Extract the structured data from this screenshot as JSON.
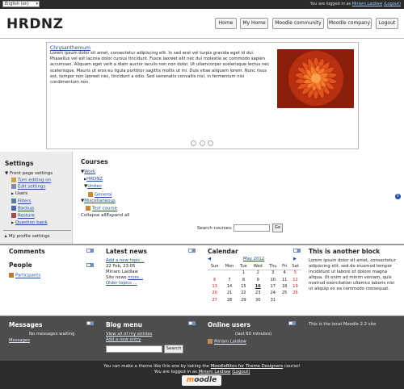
{
  "topbar": {
    "language": "English (en)",
    "logged_in_prefix": "You are logged in as",
    "user": "Miriam Laidlaw",
    "logout": "(Logout)"
  },
  "header": {
    "site_title": "HRDNZ",
    "nav": [
      "Home",
      "My Home",
      "Moodle community",
      "Moodle company",
      "Logout"
    ]
  },
  "slideshow": {
    "title": "Chrysanthemum",
    "text": "Lorem ipsum dolor sit amet, consectetur adipiscing elit. In sed erat vel turpis gravida eget id dui. Phasellus vel est lacinia dolor cursus tincidunt. Fusce laoreet elit nec dui molestie ac commodo sapien accumsan. Aliquam eget velit a diam auctor iaculis non non dolor. Ut ullamcorper scelerisque lectus nec scelerisque. Mauris ut eros eu ligula porttitor sagittis mollis ut mi. Duis vitae aliquam lorem. Nunc risus est, tempor non laoreet nec, tincidunt a odio. Sed venenatis convallis nisl, in fermentum nisi condimentum non.",
    "pager": [
      "1",
      "2",
      "3"
    ]
  },
  "settings": {
    "title": "Settings",
    "front_page_settings": "Front page settings",
    "items": [
      "Turn editing on",
      "Edit settings",
      "Users",
      "Filters",
      "Backup",
      "Restore",
      "Question bank"
    ],
    "my_profile": "My profile settings"
  },
  "courses": {
    "title": "Courses",
    "tree": [
      "Work",
      "HRDNZ",
      "Unitec",
      "General",
      "Miscellaneous",
      "Test course"
    ],
    "collapse": "Collapse all",
    "expand": "Expand all",
    "search_label": "Search courses:",
    "search_go": "Go"
  },
  "comments": {
    "title": "Comments"
  },
  "people": {
    "title": "People",
    "participants": "Participants"
  },
  "latest_news": {
    "title": "Latest news",
    "add_topic": "Add a new topic...",
    "date": "22 Feb, 23:05",
    "author": "Miriam Laidlaw",
    "item": "Site news",
    "more": "more...",
    "older": "Older topics ..."
  },
  "calendar": {
    "title": "Calendar",
    "month": "May 2012",
    "days": [
      "Sun",
      "Mon",
      "Tue",
      "Wed",
      "Thu",
      "Fri",
      "Sat"
    ],
    "weeks": [
      [
        "",
        "",
        "1",
        "2",
        "3",
        "4",
        "5"
      ],
      [
        "6",
        "7",
        "8",
        "9",
        "10",
        "11",
        "12"
      ],
      [
        "13",
        "14",
        "15",
        "16",
        "17",
        "18",
        "19"
      ],
      [
        "20",
        "21",
        "22",
        "23",
        "24",
        "25",
        "26"
      ],
      [
        "27",
        "28",
        "29",
        "30",
        "31",
        "",
        ""
      ]
    ],
    "today": "16"
  },
  "another_block": {
    "title": "This is another block",
    "text": [
      "Lorem ipsum dolor sit amet, consectetur",
      "adipiscing elit, sed do eiusmod tempor",
      "incididunt ut labore et dolore magna",
      "aliqua. Ut enim ad minim veniam, quis",
      "nostrud exercitation ullamco laboris nisi",
      "ut aliquip ex ea commodo consequat."
    ]
  },
  "messages": {
    "title": "Messages",
    "none": "No messages waiting",
    "link": "Messages"
  },
  "blog_menu": {
    "title": "Blog menu",
    "view_all": "View all of my entries",
    "add_entry": "Add a new entry",
    "search": "Search"
  },
  "online_users": {
    "title": "Online users",
    "period": "(last 60 minutes)",
    "user": "Miriam Laidlaw"
  },
  "local_site": {
    "text": "This is the local Moodle 2.2 site"
  },
  "footer": {
    "line1_a": "You can make a theme like this one by taking the",
    "line1_link": "MoodleBites for Theme Designers",
    "line1_b": "course!",
    "line2_prefix": "You are logged in as",
    "user": "Miriam Laidlaw",
    "logout": "(Logout)",
    "logo": "moodle"
  },
  "colors": {
    "accent": "#1a4a9a",
    "dark_bg": "#4a4a4a",
    "footer_bg": "#2c2c2c",
    "flower": "#d9441a"
  }
}
